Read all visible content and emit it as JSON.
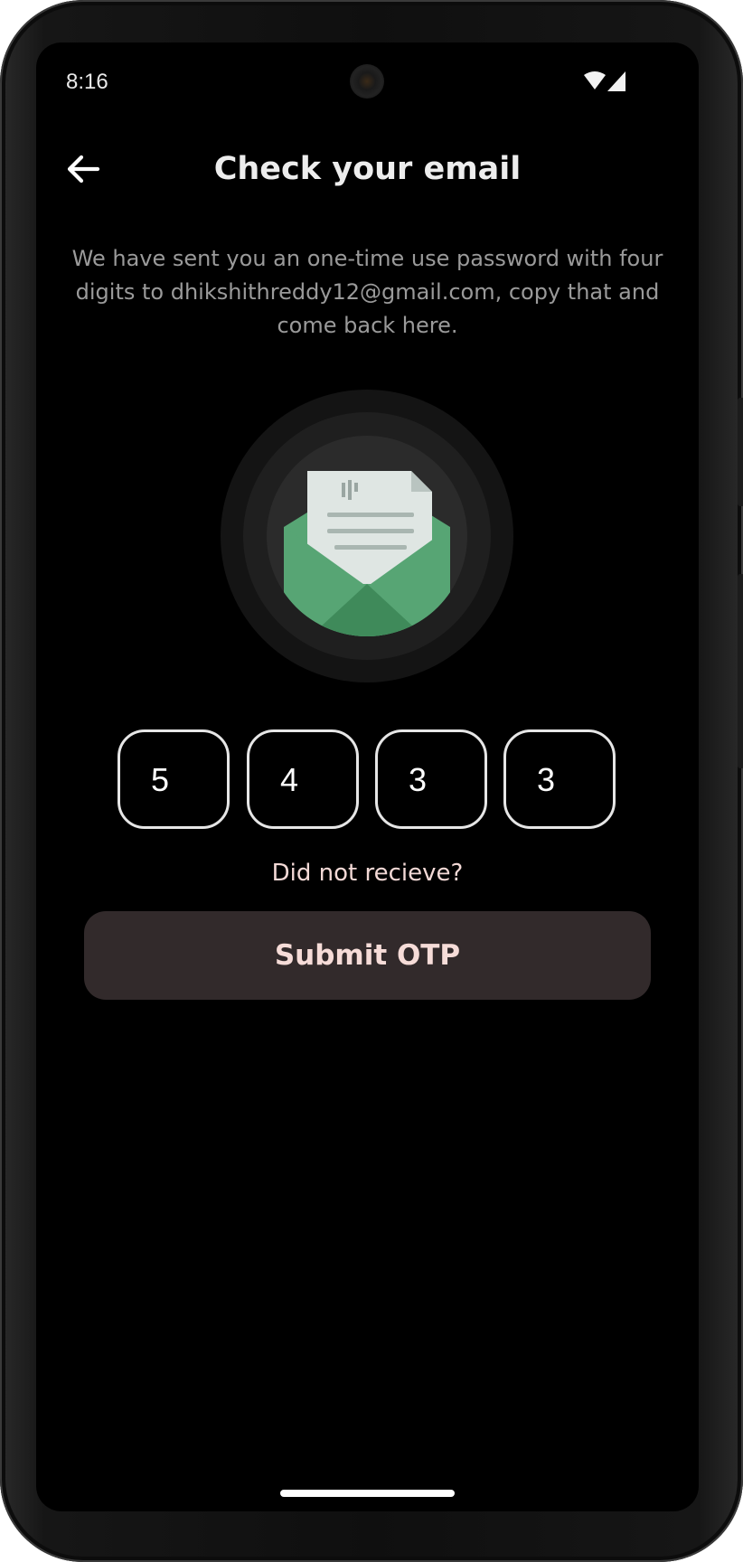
{
  "status_bar": {
    "time": "8:16",
    "icons": [
      "wifi-icon",
      "cell-signal-icon"
    ]
  },
  "header": {
    "title": "Check your email",
    "back_icon": "arrow-left-icon"
  },
  "description": "We have sent you an one-time use password with four digits to dhikshithreddy12@gmail.com, copy that and come back here.",
  "illustration": {
    "icon": "open-envelope-letter-icon",
    "colors": {
      "ring_outer": "#141414",
      "ring_middle": "#1f1f1f",
      "ring_inner": "#2b2b2b",
      "envelope": "#57a574",
      "envelope_dark": "#3f8a5a",
      "letter": "#dfe6e3"
    }
  },
  "otp": {
    "digits": [
      "5",
      "4",
      "3",
      "3"
    ]
  },
  "resend_label": "Did not recieve?",
  "submit_label": "Submit OTP",
  "colors": {
    "background": "#000000",
    "title": "#ededed",
    "description": "#9a9a9a",
    "accent_text": "#f3d9d6",
    "button_bg": "#322a2b"
  }
}
